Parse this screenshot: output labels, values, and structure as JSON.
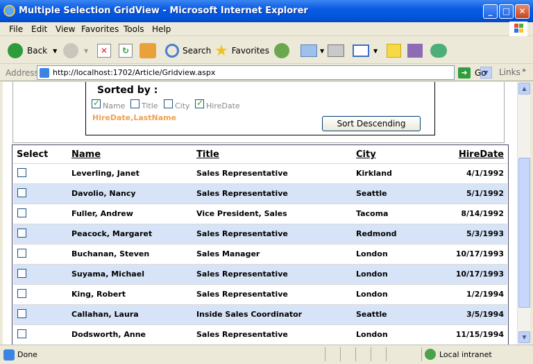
{
  "window": {
    "title": "Multiple Selection GridView - Microsoft Internet Explorer"
  },
  "menu": [
    "File",
    "Edit",
    "View",
    "Favorites",
    "Tools",
    "Help"
  ],
  "toolbar": {
    "back_label": "Back",
    "search_label": "Search",
    "favorites_label": "Favorites"
  },
  "address": {
    "label": "Address",
    "url": "http://localhost:1702/Article/Gridview.aspx",
    "go_label": "Go",
    "links_label": "Links"
  },
  "sort_panel": {
    "heading": "Sorted by :",
    "options": [
      {
        "label": "Name",
        "checked": true
      },
      {
        "label": "Title",
        "checked": false
      },
      {
        "label": "City",
        "checked": false
      },
      {
        "label": "HireDate",
        "checked": true
      }
    ],
    "current_sort": "HireDate,LastName",
    "button_label": "Sort Descending"
  },
  "grid": {
    "headers": {
      "select": "Select",
      "name": "Name",
      "title": "Title",
      "city": "City",
      "hiredate": "HireDate"
    },
    "rows": [
      {
        "name": "Leverling, Janet",
        "title": "Sales Representative",
        "city": "Kirkland",
        "hiredate": "4/1/1992"
      },
      {
        "name": "Davolio, Nancy",
        "title": "Sales Representative",
        "city": "Seattle",
        "hiredate": "5/1/1992"
      },
      {
        "name": "Fuller, Andrew",
        "title": "Vice President, Sales",
        "city": "Tacoma",
        "hiredate": "8/14/1992"
      },
      {
        "name": "Peacock, Margaret",
        "title": "Sales Representative",
        "city": "Redmond",
        "hiredate": "5/3/1993"
      },
      {
        "name": "Buchanan, Steven",
        "title": "Sales Manager",
        "city": "London",
        "hiredate": "10/17/1993"
      },
      {
        "name": "Suyama, Michael",
        "title": "Sales Representative",
        "city": "London",
        "hiredate": "10/17/1993"
      },
      {
        "name": "King, Robert",
        "title": "Sales Representative",
        "city": "London",
        "hiredate": "1/2/1994"
      },
      {
        "name": "Callahan, Laura",
        "title": "Inside Sales Coordinator",
        "city": "Seattle",
        "hiredate": "3/5/1994"
      },
      {
        "name": "Dodsworth, Anne",
        "title": "Sales Representative",
        "city": "London",
        "hiredate": "11/15/1994"
      }
    ]
  },
  "status": {
    "text": "Done",
    "zone": "Local intranet"
  },
  "colors": {
    "titlebar": "#0a5ce5",
    "alt_row": "#d7e4f8",
    "sort_result": "#f0a050"
  }
}
